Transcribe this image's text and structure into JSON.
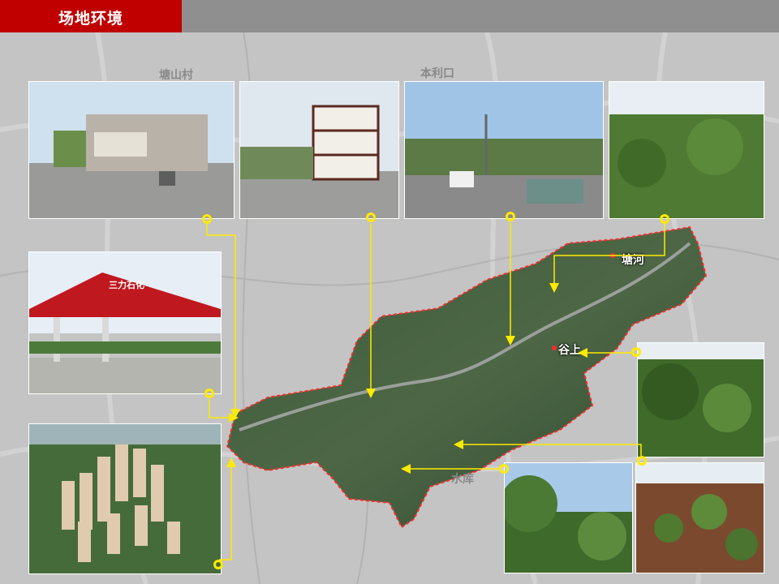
{
  "header": {
    "title": "场地环境"
  },
  "colors": {
    "header_red": "#c00000",
    "header_gray": "#8f8f8f",
    "arrow": "#ffea00",
    "boundary": "#ff2a2a"
  },
  "map_labels": {
    "top_left": "塘山村",
    "top_center": "本利口",
    "east_village": "塘河",
    "center_village": "谷上",
    "south_village": "水库"
  },
  "photos": {
    "gas_station_sign": "三力石化"
  }
}
